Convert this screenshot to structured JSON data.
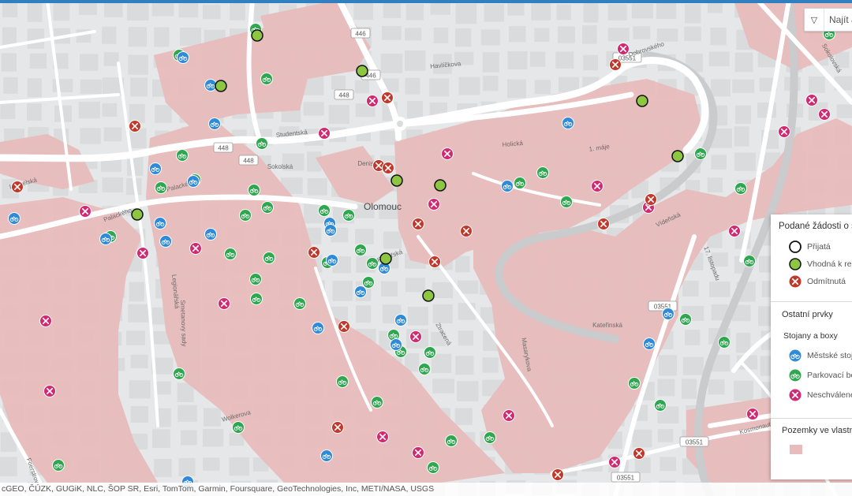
{
  "search": {
    "placeholder": "Najít a"
  },
  "map": {
    "city_label": "Olomouc",
    "colors": {
      "background": "#e6e7e8",
      "block": "#d9dbdc",
      "owned_land": "#e8bcbc",
      "road": "#ffffff",
      "river": "#c9cbcd",
      "green": "#8dc641",
      "blue": "#2f8ad8",
      "green_box": "#2ea74f",
      "red_x": "#c0392b",
      "magenta_x": "#d02b72"
    },
    "road_labels": [
      "Palackého",
      "Studentská",
      "Sokolská",
      "Dobrovského",
      "Havlíčkova",
      "Vídeňská",
      "1. máje",
      "17. listopadu",
      "Holická",
      "Kosmonautů",
      "Denisova",
      "Ztracená",
      "Pekařská",
      "Kateřinská",
      "Sokolovská",
      "Legionářská",
      "Masarykova",
      "Smetanovy sady",
      "Foerstrova",
      "Wolkerova",
      "Litovelská",
      "Palackého"
    ],
    "route_shields": [
      "446",
      "448",
      "448",
      "448",
      "03551",
      "03551",
      "03551",
      "03551",
      "446"
    ],
    "markers": {
      "accepted": [],
      "suitable": [
        [
          326,
          45
        ],
        [
          280,
          109
        ],
        [
          459,
          90
        ],
        [
          814,
          128
        ],
        [
          859,
          198
        ],
        [
          503,
          229
        ],
        [
          558,
          235
        ],
        [
          174,
          272
        ],
        [
          489,
          328
        ],
        [
          543,
          375
        ]
      ],
      "rejected": [
        [
          780,
          82
        ],
        [
          491,
          124
        ],
        [
          171,
          160
        ],
        [
          480,
          210
        ],
        [
          492,
          213
        ],
        [
          22,
          237
        ],
        [
          825,
          253
        ],
        [
          530,
          284
        ],
        [
          591,
          293
        ],
        [
          765,
          284
        ],
        [
          398,
          320
        ],
        [
          551,
          332
        ],
        [
          436,
          414
        ],
        [
          428,
          542
        ],
        [
          810,
          575
        ],
        [
          707,
          602
        ]
      ],
      "city_racks": [
        [
          232,
          73
        ],
        [
          267,
          108
        ],
        [
          720,
          156
        ],
        [
          272,
          157
        ],
        [
          197,
          214
        ],
        [
          245,
          230
        ],
        [
          643,
          236
        ],
        [
          18,
          277
        ],
        [
          203,
          283
        ],
        [
          418,
          283
        ],
        [
          134,
          303
        ],
        [
          210,
          306
        ],
        [
          267,
          297
        ],
        [
          419,
          292
        ],
        [
          421,
          330
        ],
        [
          487,
          340
        ],
        [
          457,
          370
        ],
        [
          403,
          416
        ],
        [
          508,
          406
        ],
        [
          847,
          398
        ],
        [
          823,
          436
        ],
        [
          502,
          437
        ],
        [
          414,
          578
        ],
        [
          238,
          611
        ]
      ],
      "parking_boxes": [
        [
          324,
          37
        ],
        [
          227,
          70
        ],
        [
          338,
          100
        ],
        [
          1051,
          43
        ],
        [
          231,
          197
        ],
        [
          332,
          182
        ],
        [
          247,
          228
        ],
        [
          204,
          238
        ],
        [
          322,
          241
        ],
        [
          339,
          263
        ],
        [
          311,
          273
        ],
        [
          411,
          267
        ],
        [
          442,
          273
        ],
        [
          659,
          232
        ],
        [
          688,
          219
        ],
        [
          718,
          256
        ],
        [
          888,
          195
        ],
        [
          939,
          239
        ],
        [
          140,
          300
        ],
        [
          292,
          322
        ],
        [
          341,
          327
        ],
        [
          457,
          317
        ],
        [
          415,
          333
        ],
        [
          324,
          354
        ],
        [
          467,
          358
        ],
        [
          472,
          334
        ],
        [
          380,
          385
        ],
        [
          325,
          379
        ],
        [
          950,
          331
        ],
        [
          869,
          405
        ],
        [
          918,
          434
        ],
        [
          499,
          425
        ],
        [
          508,
          446
        ],
        [
          545,
          447
        ],
        [
          538,
          468
        ],
        [
          434,
          484
        ],
        [
          478,
          510
        ],
        [
          227,
          474
        ],
        [
          302,
          542
        ],
        [
          572,
          559
        ],
        [
          621,
          555
        ],
        [
          804,
          486
        ],
        [
          837,
          514
        ],
        [
          74,
          590
        ],
        [
          549,
          593
        ]
      ],
      "unapproved": [
        [
          790,
          62
        ],
        [
          472,
          128
        ],
        [
          1029,
          127
        ],
        [
          1045,
          145
        ],
        [
          411,
          169
        ],
        [
          567,
          195
        ],
        [
          994,
          167
        ],
        [
          108,
          268
        ],
        [
          550,
          259
        ],
        [
          757,
          236
        ],
        [
          822,
          263
        ],
        [
          931,
          293
        ],
        [
          181,
          321
        ],
        [
          248,
          315
        ],
        [
          284,
          385
        ],
        [
          58,
          407
        ],
        [
          527,
          427
        ],
        [
          63,
          496
        ],
        [
          645,
          527
        ],
        [
          954,
          525
        ],
        [
          485,
          554
        ],
        [
          530,
          574
        ],
        [
          779,
          586
        ]
      ]
    }
  },
  "legend": {
    "title": "Podané žádosti o st",
    "items": [
      {
        "label": "Přijatá"
      },
      {
        "label": "Vhodná k realiz"
      },
      {
        "label": "Odmítnutá"
      }
    ],
    "section_title": "Ostatní prvky",
    "subsection_title": "Stojany a boxy",
    "sub_items": [
      {
        "label": "Městské stoja"
      },
      {
        "label": "Parkovací box"
      },
      {
        "label": "Neschválené"
      }
    ],
    "land_title": "Pozemky ve vlastni"
  },
  "attribution": "cGEO, ČÚZK, GUGiK, NLC, ŠOP SR, Esri, TomTom, Garmin, Foursquare, GeoTechnologies, Inc, METI/NASA, USGS"
}
